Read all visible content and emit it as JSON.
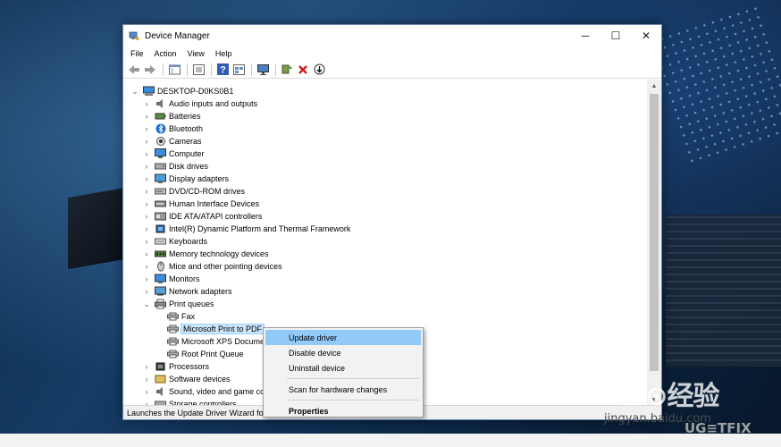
{
  "window": {
    "title": "Device Manager",
    "controls": {
      "minimize": "─",
      "maximize": "☐",
      "close": "✕"
    }
  },
  "menu": [
    "File",
    "Action",
    "View",
    "Help"
  ],
  "toolbar": [
    "back-arrow-icon",
    "forward-arrow-icon",
    "show-hide-tree-icon",
    "properties-icon",
    "help-icon",
    "view-icon",
    "monitor-icon",
    "update-driver-icon",
    "uninstall-icon",
    "download-icon"
  ],
  "tree": {
    "root": "DESKTOP-D0KS0B1",
    "items": [
      {
        "label": "Audio inputs and outputs",
        "icon": "speaker-icon"
      },
      {
        "label": "Batteries",
        "icon": "battery-icon"
      },
      {
        "label": "Bluetooth",
        "icon": "bluetooth-icon"
      },
      {
        "label": "Cameras",
        "icon": "camera-icon"
      },
      {
        "label": "Computer",
        "icon": "computer-icon"
      },
      {
        "label": "Disk drives",
        "icon": "disk-icon"
      },
      {
        "label": "Display adapters",
        "icon": "display-icon"
      },
      {
        "label": "DVD/CD-ROM drives",
        "icon": "dvd-icon"
      },
      {
        "label": "Human Interface Devices",
        "icon": "hid-icon"
      },
      {
        "label": "IDE ATA/ATAPI controllers",
        "icon": "ide-icon"
      },
      {
        "label": "Intel(R) Dynamic Platform and Thermal Framework",
        "icon": "chip-icon"
      },
      {
        "label": "Keyboards",
        "icon": "keyboard-icon"
      },
      {
        "label": "Memory technology devices",
        "icon": "memory-icon"
      },
      {
        "label": "Mice and other pointing devices",
        "icon": "mouse-icon"
      },
      {
        "label": "Monitors",
        "icon": "monitor-icon"
      },
      {
        "label": "Network adapters",
        "icon": "network-icon"
      },
      {
        "label": "Print queues",
        "icon": "printer-icon"
      }
    ],
    "print_children": [
      "Fax",
      "Microsoft Print to PDF",
      "Microsoft XPS Docume",
      "Root Print Queue"
    ],
    "after": [
      {
        "label": "Processors",
        "icon": "processor-icon"
      },
      {
        "label": "Software devices",
        "icon": "software-icon"
      },
      {
        "label": "Sound, video and game co",
        "icon": "sound-icon"
      },
      {
        "label": "Storage controllers",
        "icon": "storage-icon"
      }
    ]
  },
  "context_menu": {
    "update": "Update driver",
    "disable": "Disable device",
    "uninstall": "Uninstall device",
    "scan": "Scan for hardware changes",
    "properties": "Properties"
  },
  "status": "Launches the Update Driver Wizard fo",
  "watermark": {
    "baidu": "Bai⊙经验",
    "url": "jingyan.baidu.com",
    "ugetfix": "UG≡TFIX"
  }
}
